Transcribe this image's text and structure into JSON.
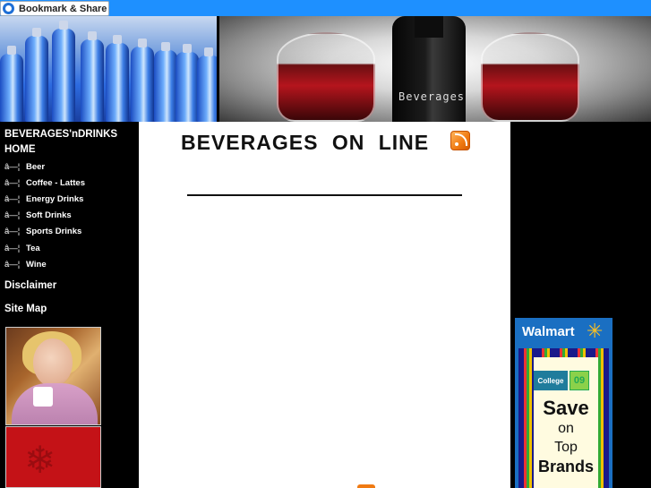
{
  "bookmark": {
    "label": "Bookmark & Share"
  },
  "header": {
    "bottle_label": "Beverages"
  },
  "sidebar": {
    "site_name": "BEVERAGES'nDRINKS",
    "home": "HOME",
    "bullet": "â—¦",
    "items": [
      "Beer",
      "Coffee - Lattes",
      "Energy Drinks",
      "Soft Drinks",
      "Sports Drinks",
      "Tea",
      "Wine"
    ],
    "disclaimer": "Disclaimer",
    "sitemap": "Site Map"
  },
  "main": {
    "title": "BEVERAGES ON LINE"
  },
  "ad": {
    "brand": "Walmart",
    "college": "College",
    "year": "09",
    "line1": "Save",
    "line2": "on",
    "line3": "Top",
    "line4": "Brands"
  },
  "colors": {
    "topbar": "#1e90ff",
    "ad_blue": "#1a6fc2",
    "rss_orange": "#f07a12"
  }
}
